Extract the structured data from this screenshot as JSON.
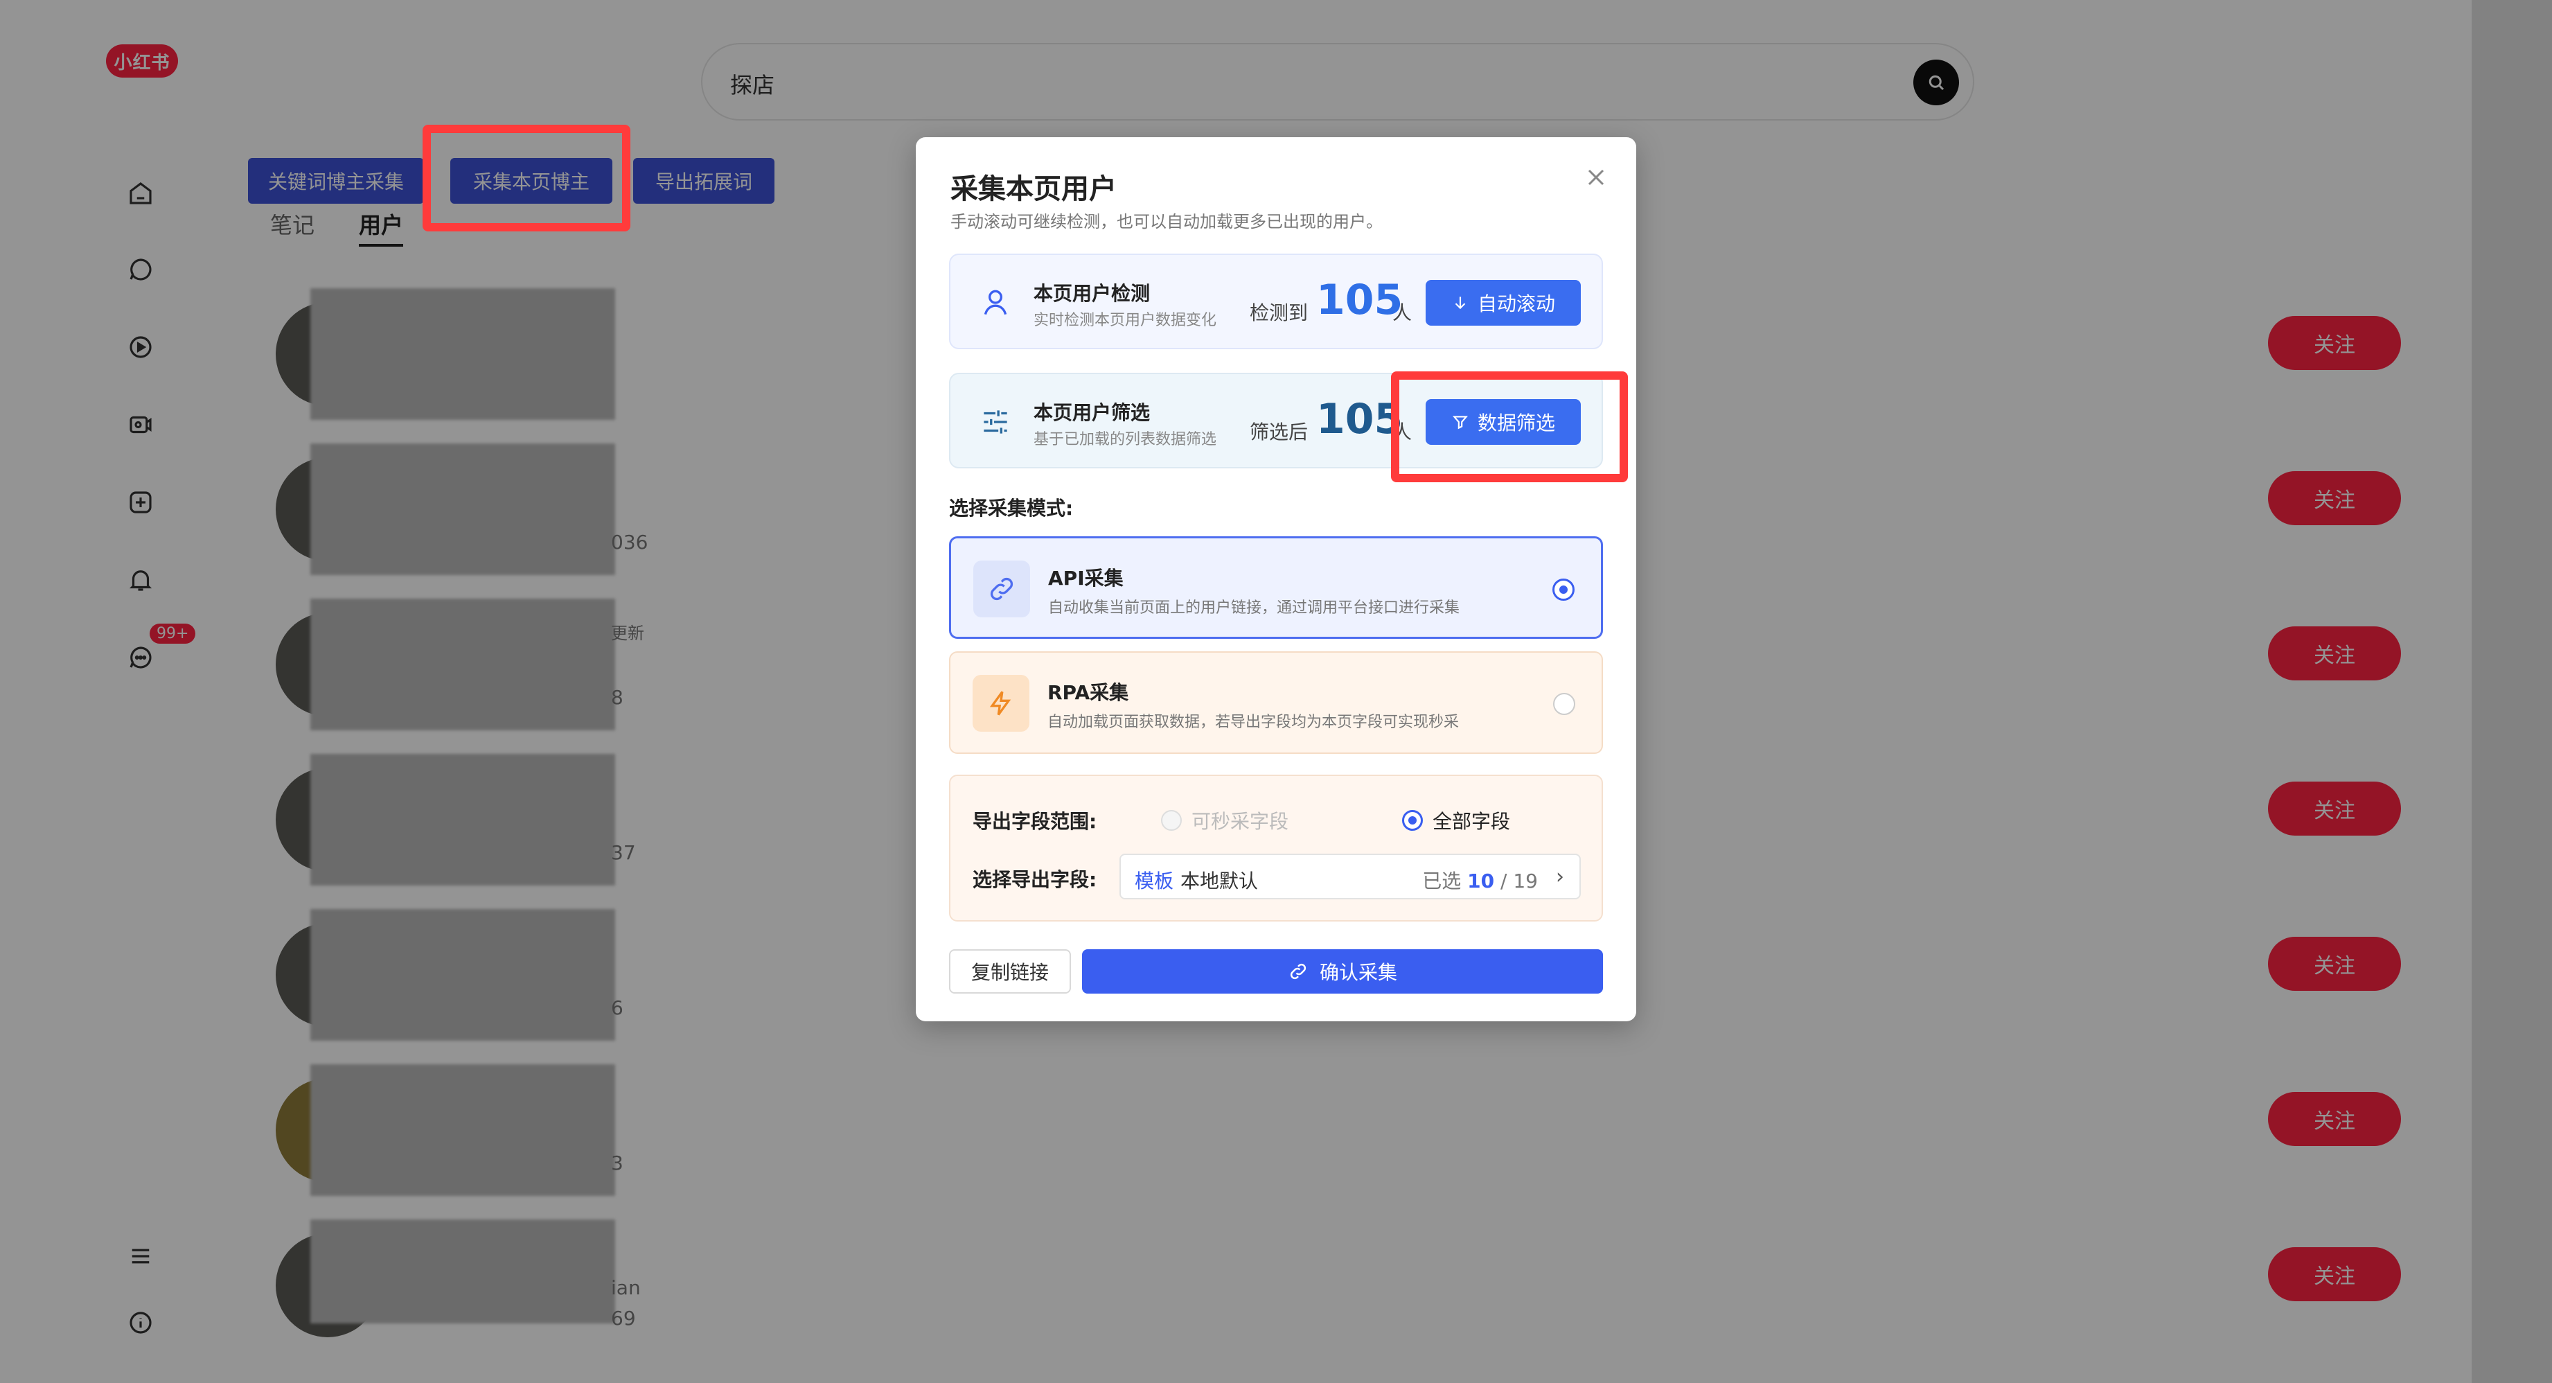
{
  "app": {
    "logo_text": "小红书",
    "notification_badge": "99+"
  },
  "search": {
    "value": "探店"
  },
  "toolbar": {
    "keyword_collect": "关键词博主采集",
    "page_collect": "采集本页博主",
    "export_words": "导出拓展词"
  },
  "tabs": [
    {
      "label": "笔记"
    },
    {
      "label": "用户"
    }
  ],
  "users": [
    {
      "side_text": "",
      "follow": "关注"
    },
    {
      "side_text": "036",
      "follow": "关注"
    },
    {
      "side_text": "更新",
      "side_text2": "8",
      "follow": "关注"
    },
    {
      "side_text": "37",
      "follow": "关注"
    },
    {
      "side_text": "6",
      "follow": "关注"
    },
    {
      "side_text": "3",
      "follow": "关注"
    },
    {
      "side_text": "ian",
      "side_text2": "69",
      "follow": "关注"
    }
  ],
  "modal": {
    "title": "采集本页用户",
    "subtitle": "手动滚动可继续检测，也可以自动加载更多已出现的用户。",
    "detect": {
      "title": "本页用户检测",
      "subtitle": "实时检测本页用户数据变化",
      "label": "检测到",
      "count": "105",
      "unit": "人",
      "button": "自动滚动"
    },
    "filter": {
      "title": "本页用户筛选",
      "subtitle": "基于已加载的列表数据筛选",
      "label": "筛选后",
      "count": "105",
      "unit": "人",
      "button": "数据筛选"
    },
    "mode_label": "选择采集模式:",
    "modes": [
      {
        "title": "API采集",
        "desc": "自动收集当前页面上的用户链接，通过调用平台接口进行采集",
        "selected": true
      },
      {
        "title": "RPA采集",
        "desc": "自动加载页面获取数据，若导出字段均为本页字段可实现秒采",
        "selected": false
      }
    ],
    "export": {
      "range_label": "导出字段范围:",
      "option_fast": "可秒采字段",
      "option_all": "全部字段",
      "field_label": "选择导出字段:",
      "template_tag": "模板",
      "template_value": "本地默认",
      "selected_prefix": "已选",
      "selected_count": "10",
      "total_count": "/ 19"
    },
    "copy_button": "复制链接",
    "confirm_button": "确认采集"
  },
  "colors": {
    "primary": "#3a5ef0",
    "brand_red": "#ff2442",
    "highlight": "#ff3b3b"
  }
}
